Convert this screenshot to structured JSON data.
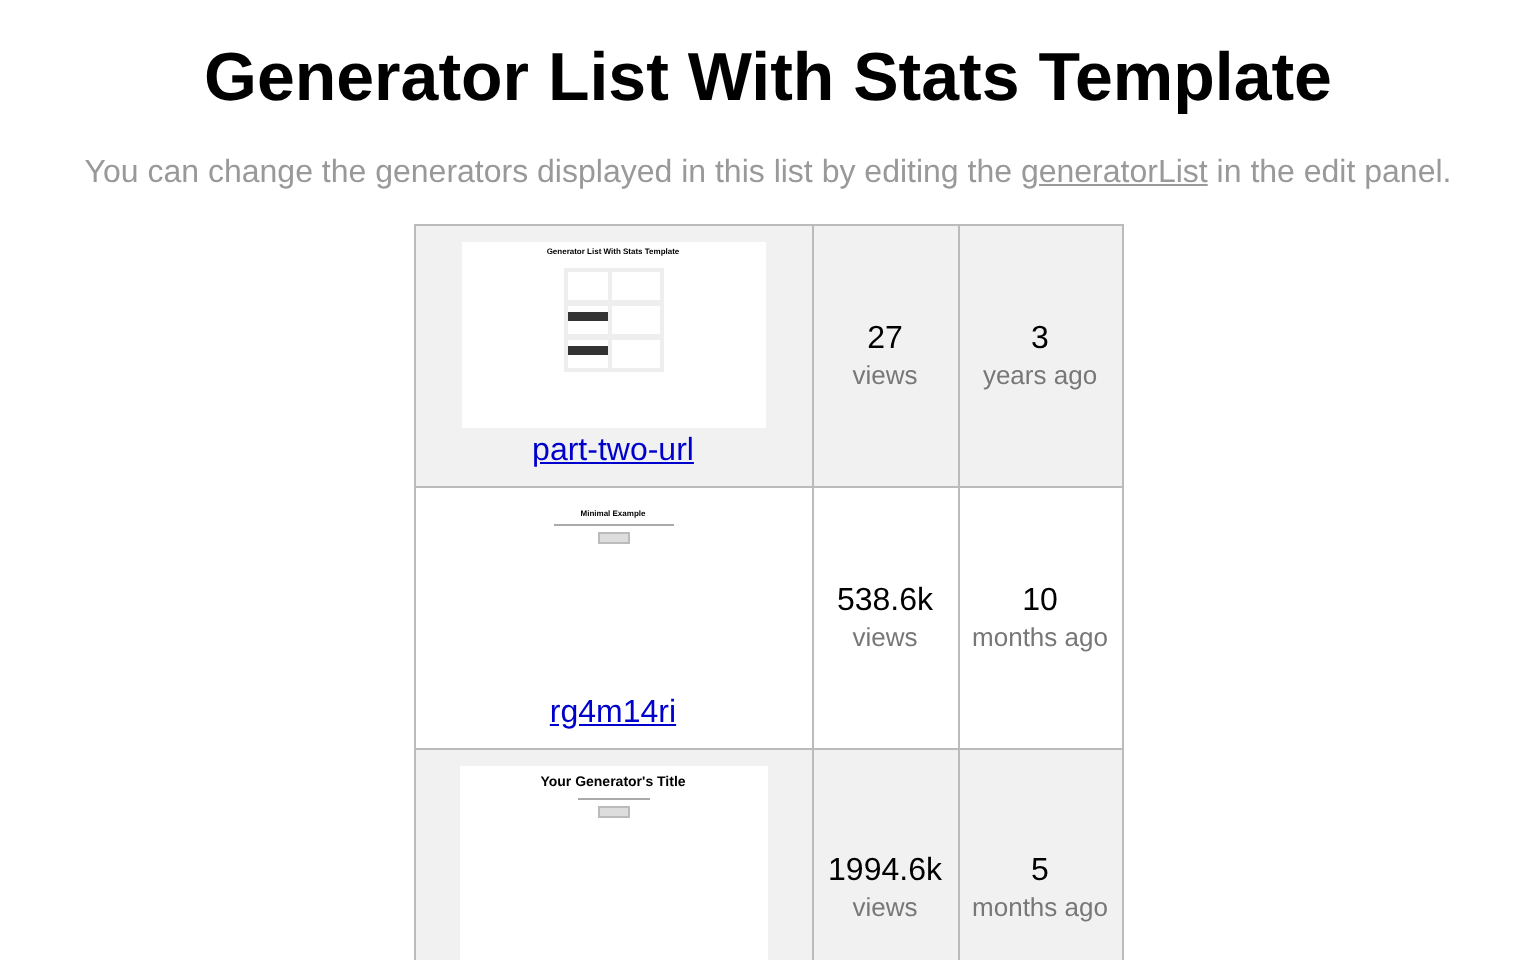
{
  "page": {
    "title": "Generator List With Stats Template",
    "intro_before": "You can change the generators displayed in this list by editing the ",
    "intro_link": "generatorList",
    "intro_after": " in the edit panel."
  },
  "generators": [
    {
      "preview": {
        "kind": "list",
        "title": "Generator List With Stats Template"
      },
      "link": "part-two-url",
      "views": "27",
      "views_label": "views",
      "age": "3",
      "age_label": "years ago"
    },
    {
      "preview": {
        "kind": "minimal",
        "title": "Minimal Example"
      },
      "link": "rg4m14ri",
      "views": "538.6k",
      "views_label": "views",
      "age": "10",
      "age_label": "months ago"
    },
    {
      "preview": {
        "kind": "title",
        "title": "Your Generator's Title"
      },
      "views": "1994.6k",
      "views_label": "views",
      "age": "5",
      "age_label": "months ago"
    }
  ]
}
